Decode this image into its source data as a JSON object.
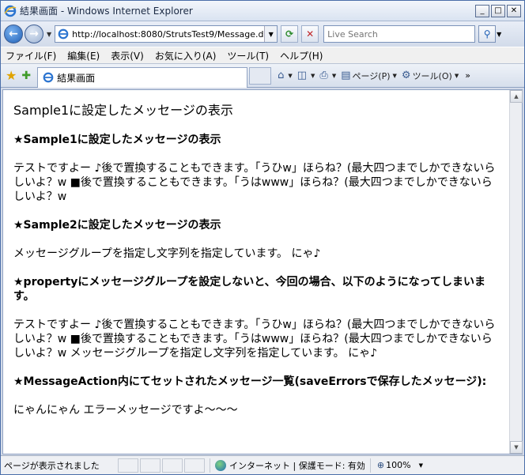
{
  "window": {
    "title": "結果画面 - Windows Internet Explorer"
  },
  "address": {
    "url": "http://localhost:8080/StrutsTest9/Message.do;"
  },
  "search": {
    "placeholder": "Live Search"
  },
  "menu": [
    "ファイル(F)",
    "編集(E)",
    "表示(V)",
    "お気に入り(A)",
    "ツール(T)",
    "ヘルプ(H)"
  ],
  "tab": {
    "label": "結果画面"
  },
  "commands": {
    "page": "ページ(P)",
    "tools": "ツール(O)",
    "more": "»"
  },
  "content": {
    "title": "Sample1に設定したメッセージの表示",
    "sections": [
      {
        "heading": "★Sample1に設定したメッセージの表示",
        "body": "テストですよー ♪後で置換することもできます。「うひw」ほらね？(最大四つまでしかできないらしいよ？w ■後で置換することもできます。「うはwww」ほらね？(最大四つまでしかできないらしいよ？w"
      },
      {
        "heading": "★Sample2に設定したメッセージの表示",
        "body": "メッセージグループを指定し文字列を指定しています。 にゃ♪"
      },
      {
        "heading": "★propertyにメッセージグループを設定しないと、今回の場合、以下のようになってしまいます。",
        "body": "テストですよー ♪後で置換することもできます。「うひw」ほらね？(最大四つまでしかできないらしいよ？w ■後で置換することもできます。「うはwww」ほらね？(最大四つまでしかできないらしいよ？w メッセージグループを指定し文字列を指定しています。 にゃ♪"
      },
      {
        "heading": "★MessageAction内にてセットされたメッセージ一覧(saveErrorsで保存したメッセージ):",
        "body": "にゃんにゃん エラーメッセージですよ〜〜〜"
      }
    ]
  },
  "status": {
    "text": "ページが表示されました",
    "zone": "インターネット | 保護モード: 有効",
    "zoom": "100%"
  }
}
